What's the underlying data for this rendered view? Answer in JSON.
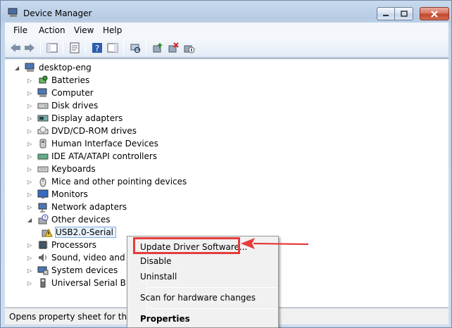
{
  "window": {
    "title": "Device Manager"
  },
  "menubar": [
    "File",
    "Action",
    "View",
    "Help"
  ],
  "tree": {
    "root": "desktop-eng",
    "items": [
      {
        "label": "Batteries",
        "icon": "battery-icon"
      },
      {
        "label": "Computer",
        "icon": "computer-icon"
      },
      {
        "label": "Disk drives",
        "icon": "disk-drive-icon"
      },
      {
        "label": "Display adapters",
        "icon": "display-adapter-icon"
      },
      {
        "label": "DVD/CD-ROM drives",
        "icon": "dvd-drive-icon"
      },
      {
        "label": "Human Interface Devices",
        "icon": "hid-icon"
      },
      {
        "label": "IDE ATA/ATAPI controllers",
        "icon": "ide-controller-icon"
      },
      {
        "label": "Keyboards",
        "icon": "keyboard-icon"
      },
      {
        "label": "Mice and other pointing devices",
        "icon": "mouse-icon"
      },
      {
        "label": "Monitors",
        "icon": "monitor-icon"
      },
      {
        "label": "Network adapters",
        "icon": "network-adapter-icon"
      },
      {
        "label": "Other devices",
        "icon": "other-devices-icon",
        "expanded": true
      },
      {
        "label": "USB2.0-Serial",
        "icon": "warning-device-icon",
        "child": true,
        "selected": true
      },
      {
        "label": "Processors",
        "icon": "processor-icon"
      },
      {
        "label": "Sound, video and",
        "icon": "sound-icon"
      },
      {
        "label": "System devices",
        "icon": "system-devices-icon"
      },
      {
        "label": "Universal Serial B",
        "icon": "usb-icon"
      }
    ]
  },
  "context_menu": {
    "items": [
      "Update Driver Software...",
      "Disable",
      "Uninstall",
      "Scan for hardware changes",
      "Properties"
    ]
  },
  "status": {
    "text": "Opens property sheet for the"
  },
  "colors": {
    "highlight_annotation": "#e63c3c",
    "selection": "#cce8ff"
  }
}
